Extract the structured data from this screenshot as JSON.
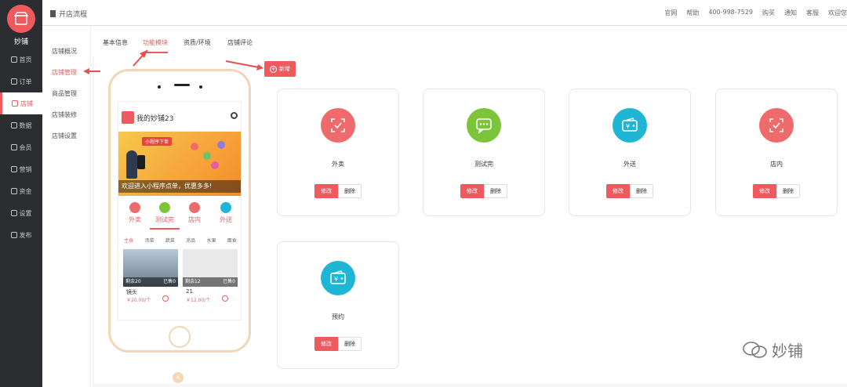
{
  "app": {
    "brand": "妙铺",
    "page_title": "开店流程"
  },
  "sidebar": {
    "items": [
      {
        "label": "首页"
      },
      {
        "label": "订单"
      },
      {
        "label": "店铺"
      },
      {
        "label": "数据"
      },
      {
        "label": "会员"
      },
      {
        "label": "营销"
      },
      {
        "label": "资金"
      },
      {
        "label": "设置"
      },
      {
        "label": "发布"
      }
    ],
    "active_index": 2
  },
  "topbar": {
    "links": [
      "官网",
      "帮助",
      "400-998-7529",
      "购买",
      "通知",
      "客服",
      "欢迎您"
    ]
  },
  "subnav": {
    "items": [
      "店铺概况",
      "店铺管理",
      "商品管理",
      "店铺装修",
      "店铺设置"
    ],
    "active_index": 1
  },
  "tabs": {
    "items": [
      "基本信息",
      "功能模块",
      "资质/环境",
      "店铺评论"
    ],
    "active_index": 1
  },
  "toolbar": {
    "add_label": "新增"
  },
  "modules": [
    {
      "name": "外卖",
      "icon": "check-icon",
      "color": "#ef6b6b",
      "edit": "修改",
      "delete": "删除"
    },
    {
      "name": "测试完",
      "icon": "chat-icon",
      "color": "#7cc53b",
      "edit": "修改",
      "delete": "删除"
    },
    {
      "name": "外送",
      "icon": "wallet-icon",
      "color": "#1fb6d6",
      "edit": "修改",
      "delete": "删除"
    },
    {
      "name": "店内",
      "icon": "check-icon",
      "color": "#ef6b6b",
      "edit": "修改",
      "delete": "删除"
    },
    {
      "name": "预约",
      "icon": "wallet-icon",
      "color": "#1fb6d6",
      "edit": "修改",
      "delete": "删除"
    }
  ],
  "phone_preview": {
    "shop_name": "我的妙铺23",
    "banner_tag": "小程序下单",
    "banner_text": "欢迎进入小程序点单，优惠多多!",
    "categories": [
      {
        "label": "外卖",
        "color": "#ef6b6b"
      },
      {
        "label": "测试完",
        "color": "#7cc53b"
      },
      {
        "label": "店内",
        "color": "#ef6b6b"
      },
      {
        "label": "外送",
        "color": "#1fb6d6"
      }
    ],
    "menu": [
      "主食",
      "汤菜",
      "蔬菜",
      "凉品",
      "水果",
      "面食"
    ],
    "products": [
      {
        "name": "镜头",
        "left": "剩余20",
        "sold": "已售0",
        "price": "￥20.00/个"
      },
      {
        "name": "21",
        "left": "剩余12",
        "sold": "已售0",
        "price": "￥12.00/个"
      }
    ]
  },
  "watermark": "妙铺"
}
